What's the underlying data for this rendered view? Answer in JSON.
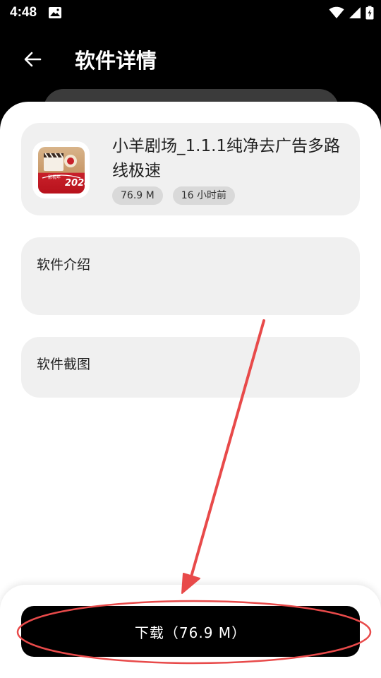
{
  "status_bar": {
    "time": "4:48"
  },
  "header": {
    "title": "软件详情"
  },
  "app": {
    "name": "小羊剧场_1.1.1纯净去广告多路线极速",
    "size": "76.9 M",
    "updated": "16 小时前",
    "icon_caption": "影视年"
  },
  "sections": {
    "intro_label": "软件介绍",
    "screenshots_label": "软件截图"
  },
  "download": {
    "label": "下载（76.9 M）"
  },
  "colors": {
    "accent_annotation": "#e84a4a",
    "button": "#000000"
  }
}
